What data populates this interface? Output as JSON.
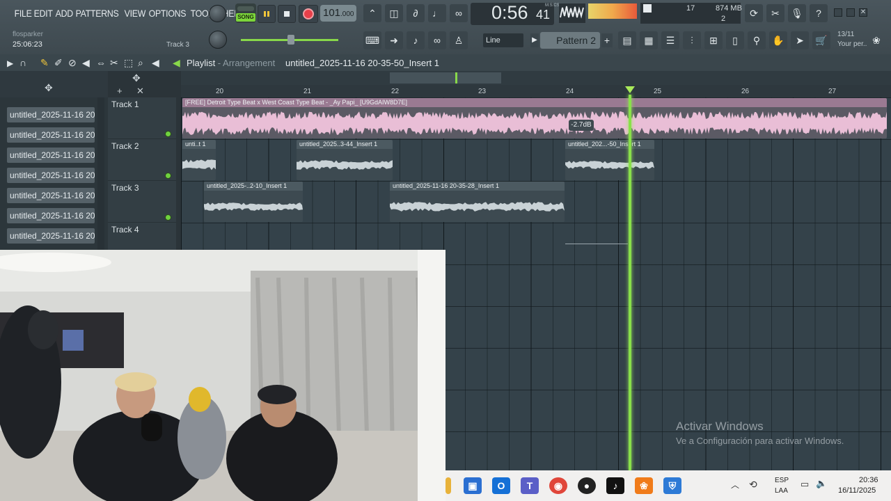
{
  "menu": [
    "FILE",
    "EDIT",
    "ADD",
    "PATTERNS",
    "VIEW",
    "OPTIONS",
    "TOOLS",
    "HELP"
  ],
  "transport": {
    "mode": "SONG",
    "tempo_int": "101",
    "tempo_frac": ".000",
    "time_main": "0:56",
    "time_sub": "41",
    "time_unit": "M:S:CS"
  },
  "perf": {
    "cpu": "17",
    "memory": "874 MB",
    "polyphony": "2"
  },
  "hint": {
    "user": "flosparker",
    "time": "25:06:23",
    "track": "Track 3"
  },
  "toolbar": {
    "snap": "Line",
    "pattern": "Pattern 2"
  },
  "news": {
    "date": "13/11",
    "text": "Your per.."
  },
  "playlist": {
    "title": "Playlist",
    "sep": " - ",
    "subtitle": "Arrangement",
    "file": "untitled_2025-11-16 20-35-50_Insert 1"
  },
  "ruler": [
    "20",
    "21",
    "22",
    "23",
    "24",
    "25",
    "26",
    "27"
  ],
  "browser": [
    "untitled_2025-11-16 20-...",
    "untitled_2025-11-16 20-...",
    "untitled_2025-11-16 20-...",
    "untitled_2025-11-16 20-...",
    "untitled_2025-11-16 20-...",
    "untitled_2025-11-16 20-...",
    "untitled_2025-11-16 20-..."
  ],
  "tracks": [
    "Track 1",
    "Track 2",
    "Track 3",
    "Track 4"
  ],
  "clips": {
    "c1": "[FREE] Detroit Type Beat x West Coast Type Beat - _Ay Papi_ [U9GdAIW8D7E]",
    "c2": "unti..t 1",
    "c3": "untitled_2025..3-44_Insert 1",
    "c4": "untitled_202...-50_Insert 1",
    "c5": "untitled_2025-..2-10_Insert 1",
    "c6": "untitled_2025-11-16 20-35-28_Insert 1"
  },
  "tooltip": "-2.7dB",
  "watermark": {
    "title": "Activar Windows",
    "sub": "Ve a Configuración para activar Windows."
  },
  "taskbar": {
    "lang1": "ESP",
    "lang2": "LAA",
    "time": "20:36",
    "date": "16/11/2025"
  },
  "colors": {
    "accent_green": "#89e04a",
    "clip_pink": "#e9bed6",
    "clip_gray": "#c9d2d6",
    "record_red": "#e8404a"
  }
}
